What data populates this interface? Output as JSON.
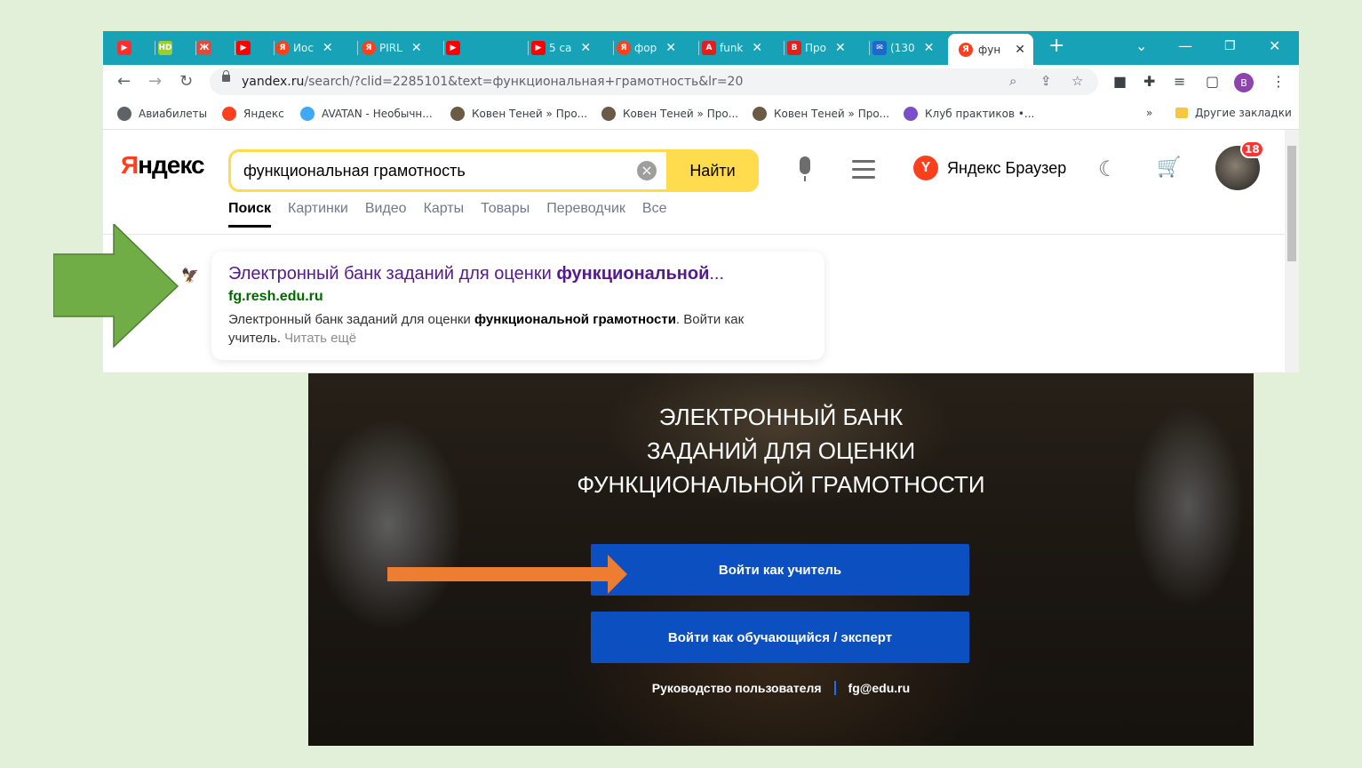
{
  "browser": {
    "tabs": [
      {
        "label": "",
        "favicon": "play-icon",
        "color": "#ff2d2d"
      },
      {
        "label": "",
        "favicon": "hd-icon",
        "color": "#9acd32"
      },
      {
        "label": "",
        "favicon": "app-icon",
        "color": "#e04a3a"
      },
      {
        "label": "",
        "favicon": "youtube-icon",
        "color": "#ff0000"
      },
      {
        "label": "Иос",
        "favicon": "yandex-icon",
        "color": "#fc3f1d"
      },
      {
        "label": "PIRL",
        "favicon": "yandex-icon",
        "color": "#fc3f1d"
      },
      {
        "label": "",
        "favicon": "youtube-icon",
        "color": "#ff0000"
      },
      {
        "label": "5 са",
        "favicon": "youtube-icon",
        "color": "#ff0000"
      },
      {
        "label": "фор",
        "favicon": "yandex-icon",
        "color": "#fc3f1d"
      },
      {
        "label": "funk",
        "favicon": "pdf-icon",
        "color": "#e02020"
      },
      {
        "label": "Про",
        "favicon": "doc-icon",
        "color": "#e02020"
      },
      {
        "label": "(130",
        "favicon": "mail-icon",
        "color": "#1e66d0"
      }
    ],
    "active_tab": {
      "label": "фун",
      "favicon": "yandex-icon"
    },
    "new_tab": "+",
    "url_host": "yandex.ru",
    "url_path": "/search/?clid=2285101&text=функциональная+грамотность&lr=20",
    "profile_letter": "В",
    "bookmarks": [
      {
        "label": "Авиабилеты",
        "color": "#5f6368"
      },
      {
        "label": "Яндекс",
        "color": "#fc3f1d"
      },
      {
        "label": "AVATAN - Необычн...",
        "color": "#3fa9f5"
      },
      {
        "label": "Ковен Теней » Про...",
        "color": "#6b5a45"
      },
      {
        "label": "Ковен Теней » Про...",
        "color": "#6b5a45"
      },
      {
        "label": "Ковен Теней » Про...",
        "color": "#6b5a45"
      },
      {
        "label": "Клуб практиков •...",
        "color": "#7a4fc9"
      }
    ],
    "bookmarks_more": "»",
    "other_bookmarks": "Другие закладки"
  },
  "yandex": {
    "logo_first": "Я",
    "logo_rest": "ндекс",
    "query": "функциональная грамотность",
    "clear": "×",
    "find_button": "Найти",
    "browser_link": "Яндекс Браузер",
    "notifications": "18",
    "tabs": [
      "Поиск",
      "Картинки",
      "Видео",
      "Карты",
      "Товары",
      "Переводчик",
      "Все"
    ],
    "result": {
      "title_plain": "Электронный банк заданий для оценки ",
      "title_bold": "функциональной",
      "title_ellipsis": "...",
      "domain": "fg.resh.edu.ru",
      "snippet_plain": "Электронный банк заданий для оценки ",
      "snippet_bold": "функциональной грамотности",
      "snippet_tail": ". Войти как учитель.",
      "read_more": "Читать ещё"
    }
  },
  "bank": {
    "title_line1": "ЭЛЕКТРОННЫЙ БАНК",
    "title_line2": "ЗАДАНИЙ ДЛЯ ОЦЕНКИ",
    "title_line3": "ФУНКЦИОНАЛЬНОЙ ГРАМОТНОСТИ",
    "teacher_button": "Войти как учитель",
    "student_button": "Войти как обучающийся / эксперт",
    "guide_link": "Руководство пользователя",
    "email_link": "fg@edu.ru"
  },
  "colors": {
    "background": "#e2f0d9",
    "tabbar": "#17a2b8",
    "yandex_yellow": "#ffdb4d",
    "bank_button": "#0b4fc1",
    "green_arrow": "#70ad47",
    "orange_arrow": "#ed7d31"
  }
}
